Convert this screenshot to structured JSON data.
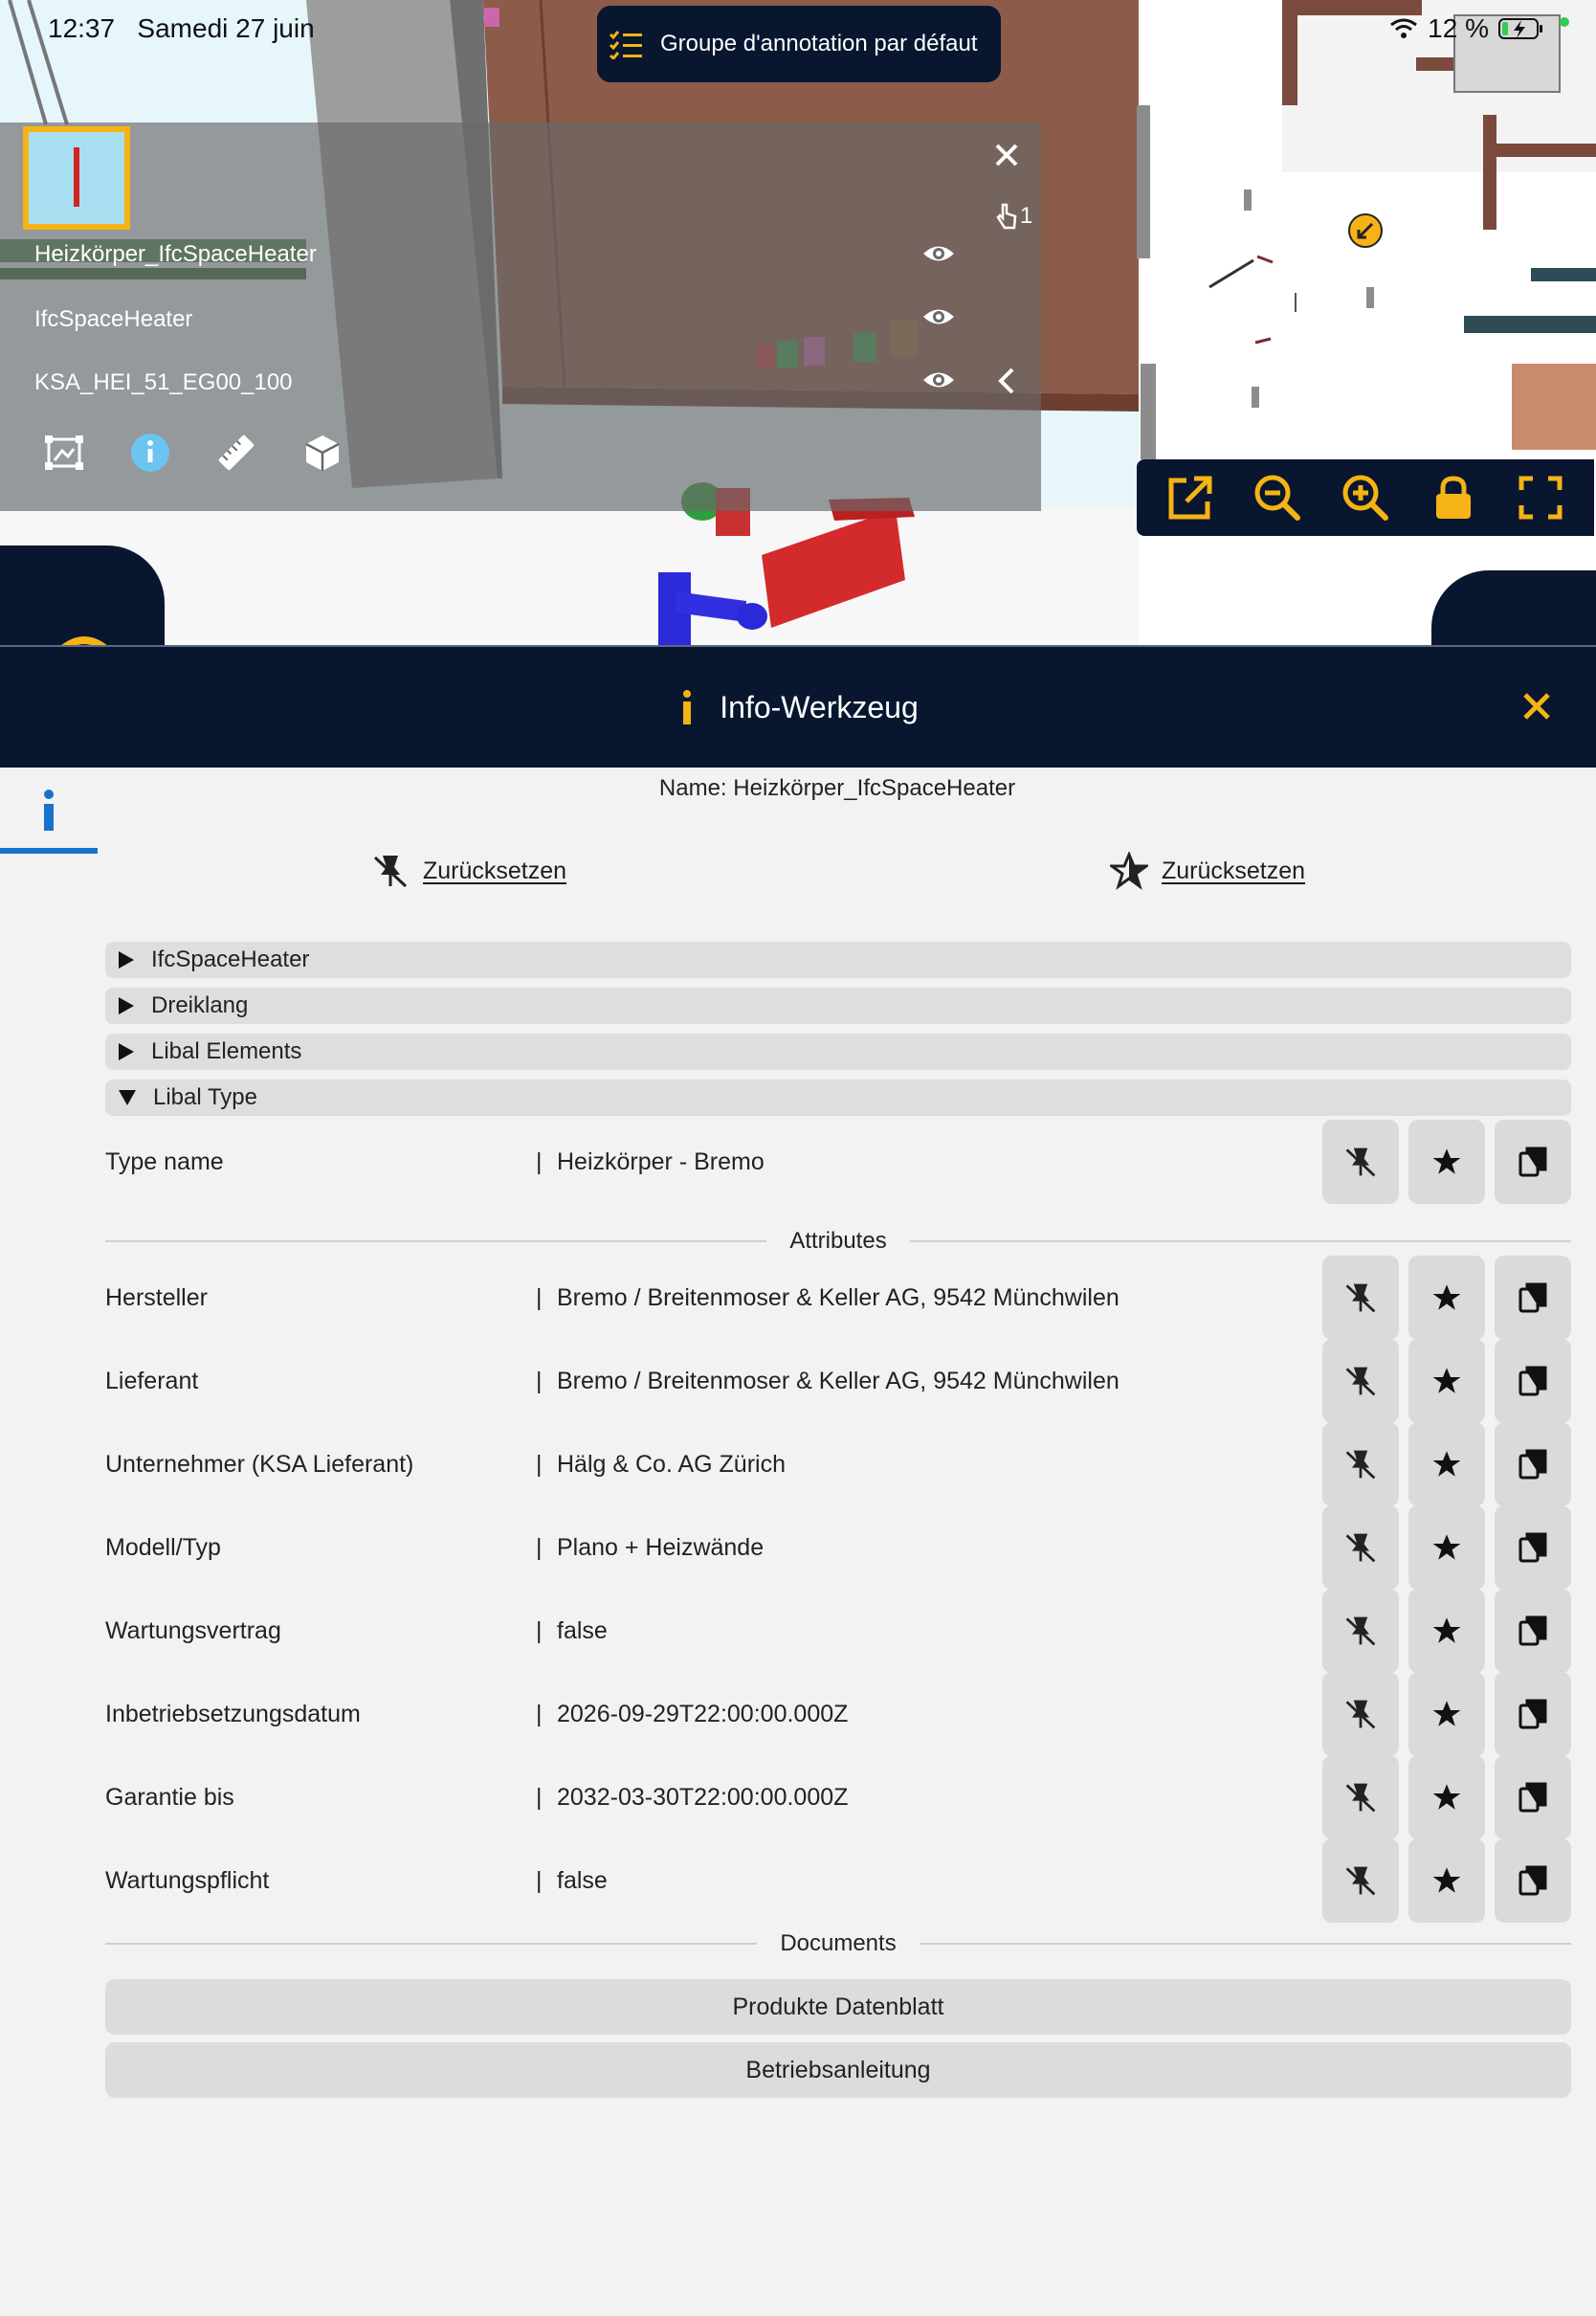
{
  "status_bar": {
    "time": "12:37",
    "date": "Samedi 27 juin",
    "battery": "12 %"
  },
  "annotation_group": {
    "label": "Groupe d'annotation par défaut"
  },
  "selection": {
    "name": "Heizkörper_IfcSpaceHeater",
    "type": "IfcSpaceHeater",
    "code": "KSA_HEI_51_EG00_100",
    "count": "1"
  },
  "info_tool": {
    "title": "Info-Werkzeug",
    "name_line": "Name: Heizkörper_IfcSpaceHeater",
    "reset_pins_label": "Zurücksetzen",
    "reset_favorites_label": "Zurücksetzen",
    "sections": [
      {
        "label": "IfcSpaceHeater",
        "expanded": false
      },
      {
        "label": "Dreiklang",
        "expanded": false
      },
      {
        "label": "Libal Elements",
        "expanded": false
      },
      {
        "label": "Libal Type",
        "expanded": true
      }
    ],
    "type_row": {
      "key": "Type name",
      "value": "Heizkörper - Bremo"
    },
    "attributes_label": "Attributes",
    "attributes": [
      {
        "key": "Hersteller",
        "value": "Bremo / Breitenmoser & Keller AG, 9542 Münchwilen"
      },
      {
        "key": "Lieferant",
        "value": "Bremo / Breitenmoser & Keller AG, 9542 Münchwilen"
      },
      {
        "key": "Unternehmer (KSA Lieferant)",
        "value": "Hälg & Co. AG Zürich"
      },
      {
        "key": "Modell/Typ",
        "value": "Plano + Heizwände"
      },
      {
        "key": "Wartungsvertrag",
        "value": "false"
      },
      {
        "key": "Inbetriebsetzungsdatum",
        "value": "2026-09-29T22:00:00.000Z"
      },
      {
        "key": "Garantie bis",
        "value": "2032-03-30T22:00:00.000Z"
      },
      {
        "key": "Wartungspflicht",
        "value": "false"
      }
    ],
    "separator": "|",
    "documents_label": "Documents",
    "documents": [
      "Produkte Datenblatt",
      "Betriebsanleitung"
    ]
  },
  "colors": {
    "navy": "#08172f",
    "accent_yellow": "#f5b316",
    "info_blue": "#1772c9",
    "button_gray": "#dadada"
  },
  "icons": {
    "group_pill": "checklist-icon",
    "selection_tools": [
      "frame-icon",
      "info-icon",
      "ruler-icon",
      "cube-icon"
    ],
    "view_controls": [
      "external-link-icon",
      "zoom-out-icon",
      "zoom-in-icon",
      "lock-icon",
      "fullscreen-icon"
    ],
    "row_actions": [
      "pin-off-icon",
      "star-icon",
      "copy-icon"
    ]
  }
}
